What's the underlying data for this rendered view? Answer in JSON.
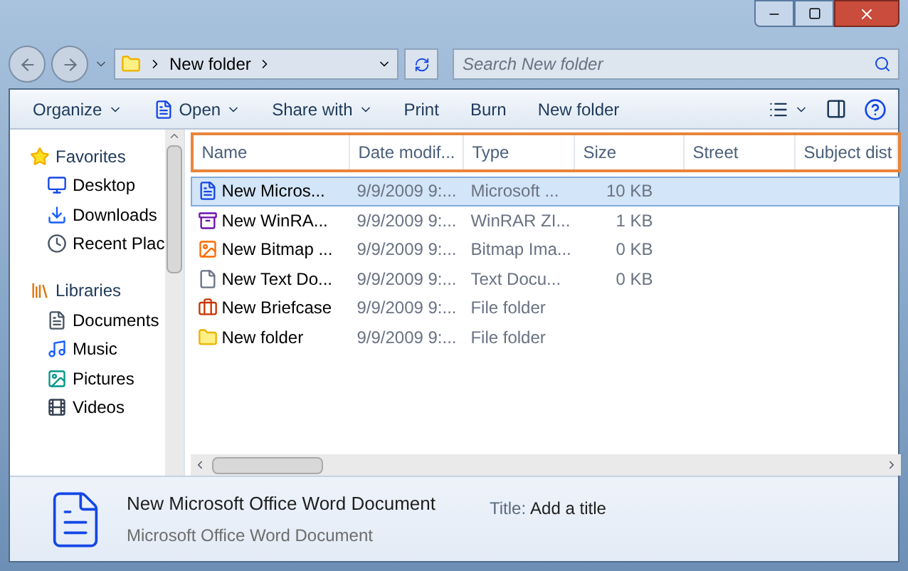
{
  "address": {
    "crumb": "New folder"
  },
  "search": {
    "placeholder": "Search New folder"
  },
  "toolbar": [
    {
      "label": "Organize",
      "kind": "menu"
    },
    {
      "label": "Open",
      "kind": "open"
    },
    {
      "label": "Share with",
      "kind": "menu"
    },
    {
      "label": "Print",
      "kind": "plain"
    },
    {
      "label": "Burn",
      "kind": "plain"
    },
    {
      "label": "New folder",
      "kind": "plain"
    }
  ],
  "sidebar": [
    {
      "label": "Favorites",
      "kind": "star",
      "children": [
        {
          "label": "Desktop",
          "kind": "desktop"
        },
        {
          "label": "Downloads",
          "kind": "downloads"
        },
        {
          "label": "Recent Plac",
          "kind": "recent"
        }
      ]
    },
    {
      "label": "Libraries",
      "kind": "library",
      "children": [
        {
          "label": "Documents",
          "kind": "doc"
        },
        {
          "label": "Music",
          "kind": "music"
        },
        {
          "label": "Pictures",
          "kind": "pictures"
        },
        {
          "label": "Videos",
          "kind": "videos"
        }
      ]
    }
  ],
  "columns": [
    "Name",
    "Date modif...",
    "Type",
    "Size",
    "Street",
    "Subject dist"
  ],
  "rows": [
    {
      "name": "New Micros...",
      "date": "9/9/2009 9:...",
      "type": "Microsoft ...",
      "size": "10 KB",
      "kind": "word",
      "selected": true
    },
    {
      "name": "New WinRA...",
      "date": "9/9/2009 9:...",
      "type": "WinRAR ZI...",
      "size": "1 KB",
      "kind": "rar",
      "selected": false
    },
    {
      "name": "New Bitmap ...",
      "date": "9/9/2009 9:...",
      "type": "Bitmap Ima...",
      "size": "0 KB",
      "kind": "bitmap",
      "selected": false
    },
    {
      "name": "New Text Do...",
      "date": "9/9/2009 9:...",
      "type": "Text Docu...",
      "size": "0 KB",
      "kind": "text",
      "selected": false
    },
    {
      "name": "New Briefcase",
      "date": "9/9/2009 9:...",
      "type": "File folder",
      "kind": "briefcase",
      "selected": false
    },
    {
      "name": "New folder",
      "date": "9/9/2009 9:...",
      "type": "File folder",
      "kind": "folder",
      "selected": false
    }
  ],
  "details": {
    "name": "New Microsoft Office Word Document",
    "type": "Microsoft Office Word Document",
    "title_label": "Title:",
    "title_value": "Add a title"
  }
}
